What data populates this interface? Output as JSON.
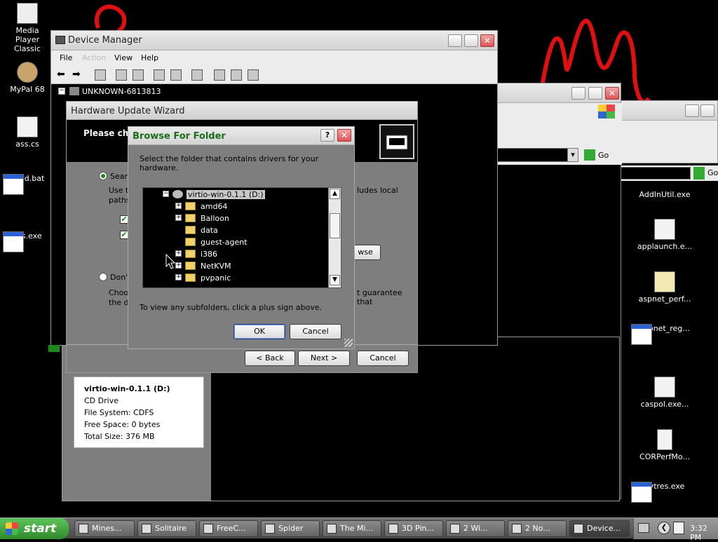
{
  "desktop_icons": [
    {
      "label": "Media Player Classic"
    },
    {
      "label": "MyPal 68"
    },
    {
      "label": "ass.cs"
    },
    {
      "label": "build.bat"
    },
    {
      "label": "ass.exe"
    }
  ],
  "right_files": [
    "AddInUtil.exe",
    "applaunch.e...",
    "aspnet_perf...",
    "aspnet_reg...",
    "caspol.exe...",
    "CORPerfMo...",
    "cvtres.exe"
  ],
  "device_manager": {
    "title": "Device Manager",
    "menu": [
      "File",
      "Action",
      "View",
      "Help"
    ],
    "tree_root": "UNKNOWN-6813813"
  },
  "bg_window": {
    "go_label": "Go"
  },
  "bg_window2": {
    "go_label": "Go"
  },
  "wizard": {
    "title": "Hardware Update Wizard",
    "heading": "Please cho",
    "option1": "Searc",
    "option1_desc_a": "Use th",
    "option1_desc_b": "paths",
    "option1_desc_right": "ludes local",
    "browse_partial": "wse",
    "option2": "Don't",
    "option2_desc_a": "Choo",
    "option2_desc_b": "the dr",
    "option2_desc_right": "t guarantee that",
    "back": "< Back",
    "next": "Next >",
    "cancel": "Cancel"
  },
  "browse_dialog": {
    "title": "Browse For Folder",
    "instruction": "Select the folder that contains drivers for your hardware.",
    "tree": [
      {
        "label": "virtio-win-0.1.1 (D:)",
        "level": 0,
        "expand": "minus",
        "type": "drive",
        "selected": true
      },
      {
        "label": "amd64",
        "level": 1,
        "expand": "plus",
        "type": "folder"
      },
      {
        "label": "Balloon",
        "level": 1,
        "expand": "plus",
        "type": "folder"
      },
      {
        "label": "data",
        "level": 1,
        "expand": "none",
        "type": "folder"
      },
      {
        "label": "guest-agent",
        "level": 1,
        "expand": "none",
        "type": "folder"
      },
      {
        "label": "i386",
        "level": 1,
        "expand": "plus",
        "type": "folder"
      },
      {
        "label": "NetKVM",
        "level": 1,
        "expand": "plus",
        "type": "folder"
      },
      {
        "label": "pvpanic",
        "level": 1,
        "expand": "plus",
        "type": "folder"
      }
    ],
    "hint": "To view any subfolders, click a plus sign above.",
    "ok": "OK",
    "cancel": "Cancel"
  },
  "drive_info": {
    "name": "virtio-win-0.1.1 (D:)",
    "type": "CD Drive",
    "fs": "File System: CDFS",
    "free": "Free Space: 0 bytes",
    "total": "Total Size: 376 MB"
  },
  "taskbar": {
    "start": "start",
    "tasks": [
      "Mines...",
      "Solitaire",
      "FreeC...",
      "Spider",
      "The Mi...",
      "3D Pin...",
      "2 Wi...",
      "2 No...",
      "Device..."
    ],
    "clock": "3:32 PM"
  },
  "colors": {
    "accent_title": "#1a6e1a",
    "selection": "#c8c8c8",
    "desktop": "#000000"
  }
}
